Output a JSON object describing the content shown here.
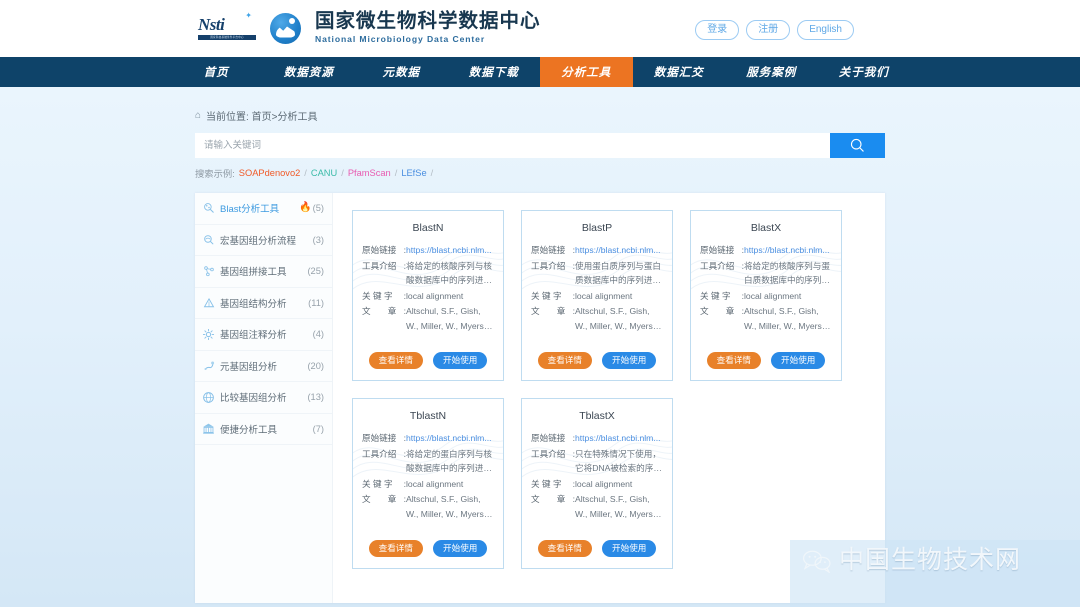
{
  "header": {
    "logo_left": {
      "word": "Nsti",
      "sub": "国家科技基础条件平台中心",
      "icon": "nsti-logo-icon"
    },
    "brand_cn": "国家微生物科学数据中心",
    "brand_en": "National Microbiology Data Center",
    "actions": [
      {
        "label": "登录",
        "name": "login-button"
      },
      {
        "label": "注册",
        "name": "register-button"
      },
      {
        "label": "English",
        "name": "language-button"
      }
    ]
  },
  "nav": {
    "items": [
      {
        "label": "首页",
        "active": false
      },
      {
        "label": "数据资源",
        "active": false
      },
      {
        "label": "元数据",
        "active": false
      },
      {
        "label": "数据下载",
        "active": false
      },
      {
        "label": "分析工具",
        "active": true
      },
      {
        "label": "数据汇交",
        "active": false
      },
      {
        "label": "服务案例",
        "active": false
      },
      {
        "label": "关于我们",
        "active": false
      }
    ],
    "active_color": "#ec7422",
    "bar_color": "#0e4369"
  },
  "breadcrumb": {
    "home_icon": "home-icon",
    "text": "当前位置: 首页>分析工具"
  },
  "search": {
    "value": "",
    "placeholder": "请输入关键词",
    "button_icon": "search-icon",
    "button_color": "#1a8cf0",
    "examples_label": "搜索示例:",
    "examples": [
      {
        "label": "SOAPdenovo2",
        "color": "#f05a28"
      },
      {
        "label": "CANU",
        "color": "#3bbba8"
      },
      {
        "label": "PfamScan",
        "color": "#e85bb0"
      },
      {
        "label": "LEfSe",
        "color": "#4a8ee0"
      }
    ],
    "separator": "/"
  },
  "sidebar": {
    "items": [
      {
        "label": "Blast分析工具",
        "count": "(5)",
        "icon": "blast-magnifier-icon",
        "active": true,
        "hot": true
      },
      {
        "label": "宏基因组分析流程",
        "count": "(3)",
        "icon": "metagenome-flow-icon",
        "active": false,
        "hot": false
      },
      {
        "label": "基因组拼接工具",
        "count": "(25)",
        "icon": "genome-assembly-icon",
        "active": false,
        "hot": false
      },
      {
        "label": "基因组结构分析",
        "count": "(11)",
        "icon": "genome-structure-icon",
        "active": false,
        "hot": false
      },
      {
        "label": "基因组注释分析",
        "count": "(4)",
        "icon": "genome-annotation-icon",
        "active": false,
        "hot": false
      },
      {
        "label": "元基因组分析",
        "count": "(20)",
        "icon": "metagenome-analysis-icon",
        "active": false,
        "hot": false
      },
      {
        "label": "比较基因组分析",
        "count": "(13)",
        "icon": "comparative-genome-icon",
        "active": false,
        "hot": false
      },
      {
        "label": "便捷分析工具",
        "count": "(7)",
        "icon": "convenient-tools-icon",
        "active": false,
        "hot": false
      }
    ],
    "hot_icon": "flame-icon"
  },
  "card_labels": {
    "link": "原始链接",
    "intro": "工具介绍",
    "keyword": "关 键 字",
    "article": "文　　章",
    "colon": ":",
    "detail_button": "查看详情",
    "start_button": "开始使用",
    "detail_color": "#e8812a",
    "start_color": "#2a8ae6"
  },
  "cards": [
    {
      "title": "BlastN",
      "link": "https://blast.ncbi.nlm...",
      "intro": "将给定的核酸序列与核酸数据库中的序列进行比对",
      "keyword": "local alignment",
      "article": "Altschul, S.F., Gish, W., Miller, W., Myers, E.W..."
    },
    {
      "title": "BlastP",
      "link": "https://blast.ncbi.nlm...",
      "intro": "使用蛋白质序列与蛋白质数据库中的序列进行比对",
      "keyword": "local alignment",
      "article": "Altschul, S.F., Gish, W., Miller, W., Myers, E.W..."
    },
    {
      "title": "BlastX",
      "link": "https://blast.ncbi.nlm...",
      "intro": "将给定的核酸序列与蛋白质数据库中的序列进行...",
      "keyword": "local alignment",
      "article": "Altschul, S.F., Gish, W., Miller, W., Myers, E.W..."
    },
    {
      "title": "TblastN",
      "link": "https://blast.ncbi.nlm...",
      "intro": "将给定的蛋白序列与核酸数据库中的序列进行比对",
      "keyword": "local alignment",
      "article": "Altschul, S.F., Gish, W., Miller, W., Myers, E.W..."
    },
    {
      "title": "TblastX",
      "link": "https://blast.ncbi.nlm...",
      "intro": "只在特殊情况下使用，它将DNA被检索的序列和...",
      "keyword": "local alignment",
      "article": "Altschul, S.F., Gish, W., Miller, W., Myers, E.W..."
    }
  ],
  "watermark": {
    "text": "中国生物技术网",
    "icon": "wechat-icon"
  }
}
